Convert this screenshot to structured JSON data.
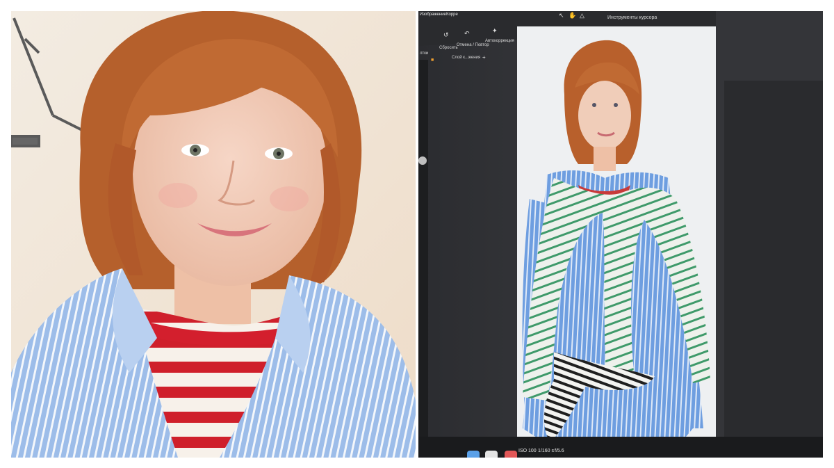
{
  "photos": {
    "left": {
      "kind": "portrait"
    },
    "right": {
      "kind": "monitor"
    }
  },
  "monitor_ui": {
    "menu": [
      "Изображение",
      "Корре"
    ],
    "tool_panel_title": "Инструменты курсора",
    "toolbar": {
      "reset_label": "Сбросить",
      "undo_redo_label": "Отмена / Повтор",
      "autocorrect_label": "Автокоррекция"
    },
    "layer_label": "Слой к...жения",
    "tools_short_label": "лтки",
    "status": {
      "iso": "ISO 100",
      "shutter": "1/160 s",
      "aperture": "f/5.6"
    }
  },
  "colors": {
    "backdrop_left": "#efe4d6",
    "hair": "#b8612d",
    "shirt_blue": "#8fb4e6",
    "stripe_red": "#d21f2c",
    "stripe_green": "#3f9a6a",
    "monitor_frame": "#3c3d40"
  }
}
